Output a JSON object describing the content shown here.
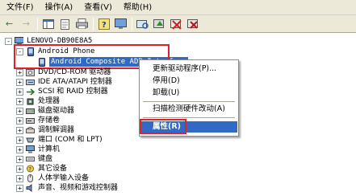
{
  "menu": [
    "文件(F)",
    "操作(A)",
    "查看(V)",
    "帮助(H)"
  ],
  "toolbar_icons": [
    "back-arrow-icon",
    "forward-arrow-icon",
    "view-pane-icon",
    "properties-icon",
    "print-icon",
    "help-icon",
    "monitor-icon",
    "scan-hardware-icon",
    "update-driver-icon",
    "disable-icon",
    "uninstall-icon"
  ],
  "tree": {
    "root": "LENOVO-DB90E8A5",
    "android_phone": "Android Phone",
    "android_adb": "Android Composite ADB Interface",
    "items": [
      "DVD/CD-ROM 驱动器",
      "IDE ATA/ATAPI 控制器",
      "SCSI 和 RAID 控制器",
      "处理器",
      "磁盘驱动器",
      "存储卷",
      "调制解调器",
      "端口 (COM 和 LPT)",
      "计算机",
      "键盘",
      "其它设备",
      "人体学输入设备",
      "声音、视频和游戏控制器"
    ]
  },
  "context_menu": {
    "update_driver": "更新驱动程序(P)...",
    "disable": "停用(D)",
    "uninstall": "卸载(U)",
    "scan": "扫描检测硬件改动(A)",
    "properties": "属性(R)"
  },
  "colors": {
    "selection": "#316ac5",
    "highlight_box": "#e0202a",
    "chrome": "#ece9d8"
  }
}
